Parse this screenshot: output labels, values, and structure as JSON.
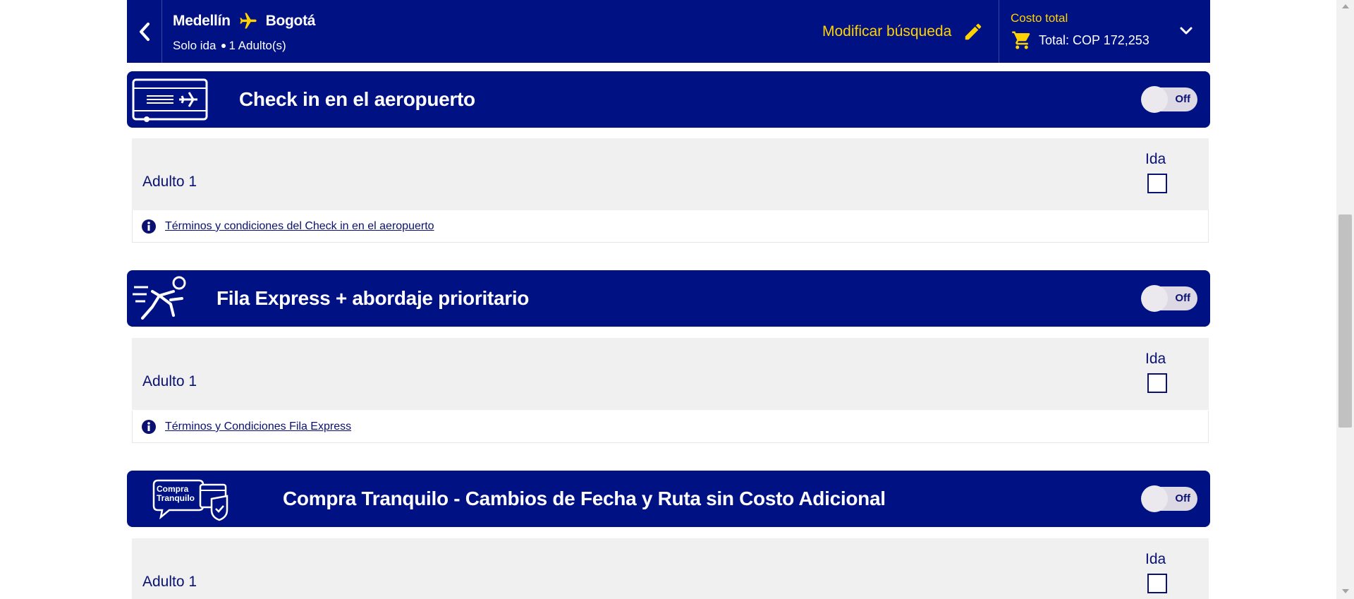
{
  "header": {
    "origin": "Medellín",
    "destination": "Bogotá",
    "trip_type": "Solo ida",
    "passengers": "1 Adulto(s)",
    "modify_label": "Modificar búsqueda",
    "cost_label": "Costo total",
    "total_label": "Total: COP 172,253"
  },
  "sections": [
    {
      "title": "Check in en el aeropuerto",
      "toggle": "Off",
      "passenger": "Adulto 1",
      "column": "Ida",
      "terms": "Términos y condiciones del Check in en el aeropuerto"
    },
    {
      "title": "Fila Express + abordaje prioritario",
      "toggle": "Off",
      "passenger": "Adulto 1",
      "column": "Ida",
      "terms": "Términos y Condiciones Fila Express"
    },
    {
      "title": "Compra Tranquilo - Cambios de Fecha y Ruta sin Costo Adicional",
      "toggle": "Off",
      "passenger": "Adulto 1",
      "column": "Ida",
      "icon_text_1": "Compra",
      "icon_text_2": "Tranquilo"
    }
  ],
  "colors": {
    "navy": "#001184",
    "accent": "#ffd200"
  },
  "icons": [
    "chevron-left-icon",
    "plane-icon",
    "pencil-icon",
    "cart-icon",
    "chevron-down-icon",
    "boarding-pass-icon",
    "runner-icon",
    "compra-tranquilo-icon",
    "info-icon"
  ]
}
